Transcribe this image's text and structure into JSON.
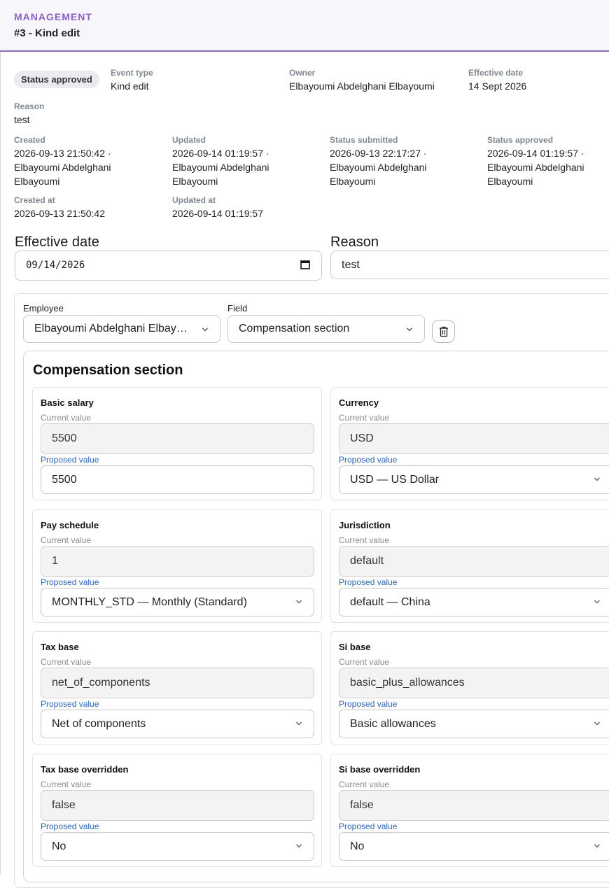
{
  "header": {
    "section": "MANAGEMENT",
    "title": "#3 - Kind edit"
  },
  "status_badge": "Status approved",
  "meta": {
    "event_type": {
      "label": "Event type",
      "value": "Kind edit"
    },
    "owner": {
      "label": "Owner",
      "value": "Elbayoumi Abdelghani Elbayoumi"
    },
    "effective_date": {
      "label": "Effective date",
      "value": "14 Sept 2026"
    },
    "reason": {
      "label": "Reason",
      "value": "test"
    },
    "created": {
      "label": "Created",
      "line1": "2026-09-13 21:50:42 ·",
      "line2": "Elbayoumi Abdelghani",
      "line3": "Elbayoumi"
    },
    "updated": {
      "label": "Updated",
      "line1": "2026-09-14 01:19:57 ·",
      "line2": "Elbayoumi Abdelghani",
      "line3": "Elbayoumi"
    },
    "status_submitted": {
      "label": "Status submitted",
      "line1": "2026-09-13 22:17:27 ·",
      "line2": "Elbayoumi Abdelghani",
      "line3": "Elbayoumi"
    },
    "status_approved": {
      "label": "Status approved",
      "line1": "2026-09-14 01:19:57 ·",
      "line2": "Elbayoumi Abdelghani",
      "line3": "Elbayoumi"
    },
    "created_at": {
      "label": "Created at",
      "value": "2026-09-13 21:50:42"
    },
    "updated_at": {
      "label": "Updated at",
      "value": "2026-09-14 01:19:57"
    }
  },
  "form": {
    "effective_date_label": "Effective date",
    "effective_date_value": "09/14/2026",
    "reason_label": "Reason",
    "reason_value": "test"
  },
  "selector": {
    "employee_label": "Employee",
    "employee_value": "Elbayoumi Abdelghani Elbayoumi",
    "field_label": "Field",
    "field_value": "Compensation section"
  },
  "section_title": "Compensation section",
  "fields_common": {
    "current_label": "Current value",
    "proposed_label": "Proposed value"
  },
  "fields": [
    {
      "title": "Basic salary",
      "current": "5500",
      "proposed": "5500",
      "proposed_is_select": false
    },
    {
      "title": "Currency",
      "current": "USD",
      "proposed": "USD — US Dollar",
      "proposed_is_select": true
    },
    {
      "title": "Pay schedule",
      "current": "1",
      "proposed": "MONTHLY_STD — Monthly (Standard)",
      "proposed_is_select": true
    },
    {
      "title": "Jurisdiction",
      "current": "default",
      "proposed": "default — China",
      "proposed_is_select": true
    },
    {
      "title": "Tax base",
      "current": "net_of_components",
      "proposed": "Net of components",
      "proposed_is_select": true
    },
    {
      "title": "Si base",
      "current": "basic_plus_allowances",
      "proposed": "Basic allowances",
      "proposed_is_select": true
    },
    {
      "title": "Tax base overridden",
      "current": "false",
      "proposed": "No",
      "proposed_is_select": true
    },
    {
      "title": "Si base overridden",
      "current": "false",
      "proposed": "No",
      "proposed_is_select": true
    }
  ],
  "colors": {
    "accent": "#8a5ec7",
    "proposed_label": "#2a66b8",
    "meta_label": "#808891",
    "badge_bg": "#e9ebef"
  }
}
